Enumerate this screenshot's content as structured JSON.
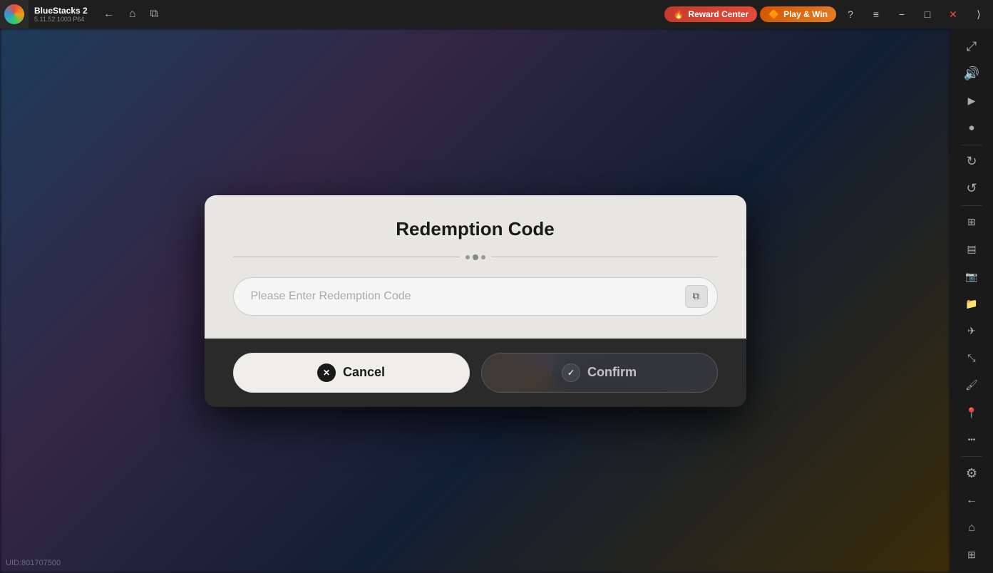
{
  "titlebar": {
    "logo_alt": "BlueStacks logo",
    "app_name": "BlueStacks 2",
    "app_version": "5.11.52.1003  P64",
    "nav_back_label": "←",
    "nav_home_label": "⌂",
    "nav_pages_label": "⧉",
    "reward_center_label": "Reward Center",
    "play_win_label": "Play & Win",
    "help_icon": "?",
    "menu_icon": "≡",
    "minimize_icon": "−",
    "maximize_icon": "□",
    "close_icon": "✕",
    "expand_icon": "⟩"
  },
  "sidebar": {
    "icons": [
      {
        "name": "fullscreen-icon",
        "symbol": "⤢",
        "interactable": true
      },
      {
        "name": "volume-icon",
        "symbol": "🔊",
        "interactable": true
      },
      {
        "name": "video-icon",
        "symbol": "▶",
        "interactable": true
      },
      {
        "name": "record-icon",
        "symbol": "⬛",
        "interactable": true
      },
      {
        "name": "refresh-icon",
        "symbol": "↻",
        "interactable": true
      },
      {
        "name": "rotate-icon",
        "symbol": "↺",
        "interactable": true
      },
      {
        "name": "stack-icon",
        "symbol": "⊞",
        "interactable": true
      },
      {
        "name": "macro-icon",
        "symbol": "▤",
        "interactable": true
      },
      {
        "name": "screenshot-icon",
        "symbol": "📷",
        "interactable": true
      },
      {
        "name": "folder-icon",
        "symbol": "📁",
        "interactable": true
      },
      {
        "name": "airplane-icon",
        "symbol": "✈",
        "interactable": true
      },
      {
        "name": "resize-icon",
        "symbol": "⤡",
        "interactable": true
      },
      {
        "name": "brush-icon",
        "symbol": "🖌",
        "interactable": true
      },
      {
        "name": "location-icon",
        "symbol": "📍",
        "interactable": true
      },
      {
        "name": "more-icon",
        "symbol": "•••",
        "interactable": true
      },
      {
        "name": "settings-icon",
        "symbol": "⚙",
        "interactable": true
      },
      {
        "name": "back-icon",
        "symbol": "←",
        "interactable": true
      },
      {
        "name": "home-icon",
        "symbol": "⌂",
        "interactable": true
      },
      {
        "name": "grid-icon",
        "symbol": "⊞",
        "interactable": true
      }
    ]
  },
  "uid": {
    "label": "UID:801707500"
  },
  "modal": {
    "title": "Redemption Code",
    "divider_dot_count": 3,
    "input_placeholder": "Please Enter Redemption Code",
    "input_value": "",
    "clipboard_icon": "⧉",
    "cancel_label": "Cancel",
    "confirm_label": "Confirm",
    "cancel_icon": "✕",
    "confirm_icon": "✓"
  }
}
